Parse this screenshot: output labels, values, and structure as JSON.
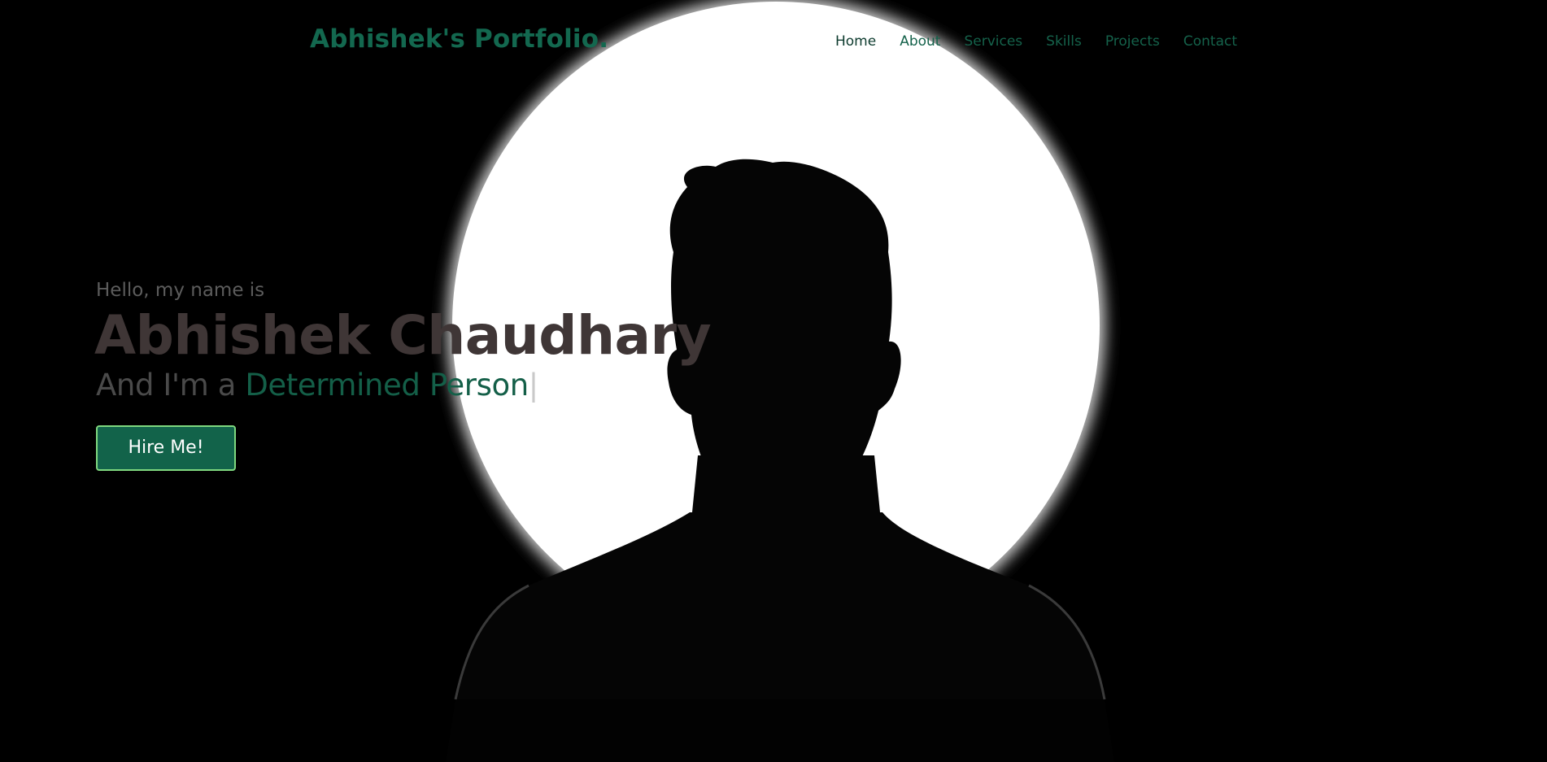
{
  "navbar": {
    "brand": "Abhishek's Portfolio.",
    "items": [
      {
        "label": "Home"
      },
      {
        "label": "About"
      },
      {
        "label": "Services"
      },
      {
        "label": "Skills"
      },
      {
        "label": "Projects"
      },
      {
        "label": "Contact"
      }
    ]
  },
  "hero": {
    "greeting": "Hello, my name is",
    "name": "Abhishek Chaudhary",
    "role_prefix": "And I'm a ",
    "role_typed": "Determined Person",
    "caret": "|",
    "cta_label": "Hire Me!"
  },
  "colors": {
    "accent": "#13684f",
    "button_border": "#7fd87f",
    "background": "#000000"
  }
}
